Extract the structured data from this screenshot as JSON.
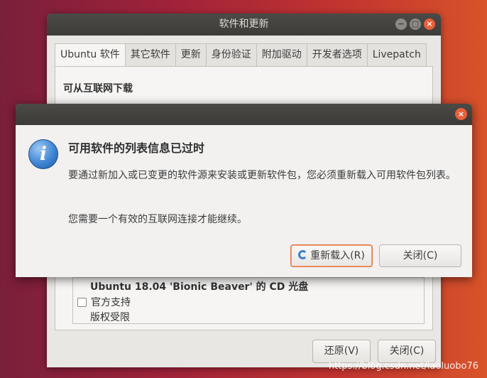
{
  "background_window": {
    "title": "软件和更新",
    "window_controls": [
      "−",
      "□",
      "×"
    ],
    "tabs": [
      "Ubuntu 软件",
      "其它软件",
      "更新",
      "身份验证",
      "附加驱动",
      "开发者选项",
      "Livepatch"
    ],
    "section_heading": "可从互联网下载",
    "cd_section": {
      "title": "Ubuntu 18.04 'Bionic Beaver' 的 CD 光盘",
      "checkbox_label": "官方支持",
      "copyright_label": "版权受限"
    },
    "buttons": {
      "revert": "还原(V)",
      "close": "关闭(C)"
    }
  },
  "dialog": {
    "close_glyph": "×",
    "icon_glyph": "i",
    "title": "可用软件的列表信息已过时",
    "message": "要通过新加入或已变更的软件源来安装或更新软件包，您必须重新载入可用软件包列表。",
    "message2": "您需要一个有效的互联网连接才能继续。",
    "buttons": {
      "reload": "重新载入(R)",
      "close": "关闭(C)"
    }
  },
  "watermark": "https://blog.csdn.net/laoluobo76",
  "colors": {
    "accent_orange": "#e9603b",
    "info_blue": "#3f86d4",
    "titlebar": "#3d3c39"
  }
}
